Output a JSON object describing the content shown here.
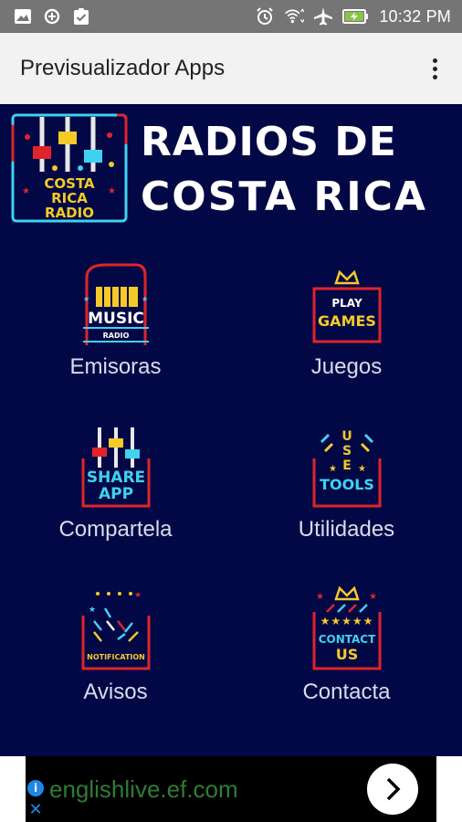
{
  "status_bar": {
    "time": "10:32 PM",
    "icons_left": [
      "image-icon",
      "data-saver-icon",
      "clipboard-check-icon"
    ],
    "icons_right": [
      "alarm-icon",
      "wifi-icon",
      "airplane-icon",
      "battery-charging-icon"
    ]
  },
  "app_bar": {
    "title": "Previsualizador Apps",
    "overflow_icon": "more-vert-icon"
  },
  "banner": {
    "title_line1": "RADIOS DE",
    "title_line2": "COSTA RICA",
    "logo_line1": "COSTA",
    "logo_line2": "RICA",
    "logo_line3": "RADIO"
  },
  "menu": [
    {
      "label": "Emisoras",
      "icon": "music-radio-icon",
      "icon_text1": "MUSIC",
      "icon_text2": "RADIO"
    },
    {
      "label": "Juegos",
      "icon": "play-games-icon",
      "icon_text1": "PLAY",
      "icon_text2": "GAMES"
    },
    {
      "label": "Compartela",
      "icon": "share-app-icon",
      "icon_text1": "SHARE",
      "icon_text2": "APP"
    },
    {
      "label": "Utilidades",
      "icon": "use-tools-icon",
      "icon_text1": "USE",
      "icon_text2": "TOOLS"
    },
    {
      "label": "Avisos",
      "icon": "notification-icon",
      "icon_text1": "NOTIFICATION",
      "icon_text2": ""
    },
    {
      "label": "Contacta",
      "icon": "contact-us-icon",
      "icon_text1": "CONTACT",
      "icon_text2": "US"
    }
  ],
  "ad": {
    "text": "englishlive.ef.com",
    "info_icon": "info-icon",
    "close_icon": "close-icon",
    "arrow_icon": "chevron-right-icon"
  },
  "colors": {
    "background": "#020845",
    "status_bar": "#757575",
    "app_bar": "#f2f2f2",
    "icon_red": "#e0242b",
    "icon_yellow": "#f6c928",
    "icon_cyan": "#3fd2f0"
  }
}
